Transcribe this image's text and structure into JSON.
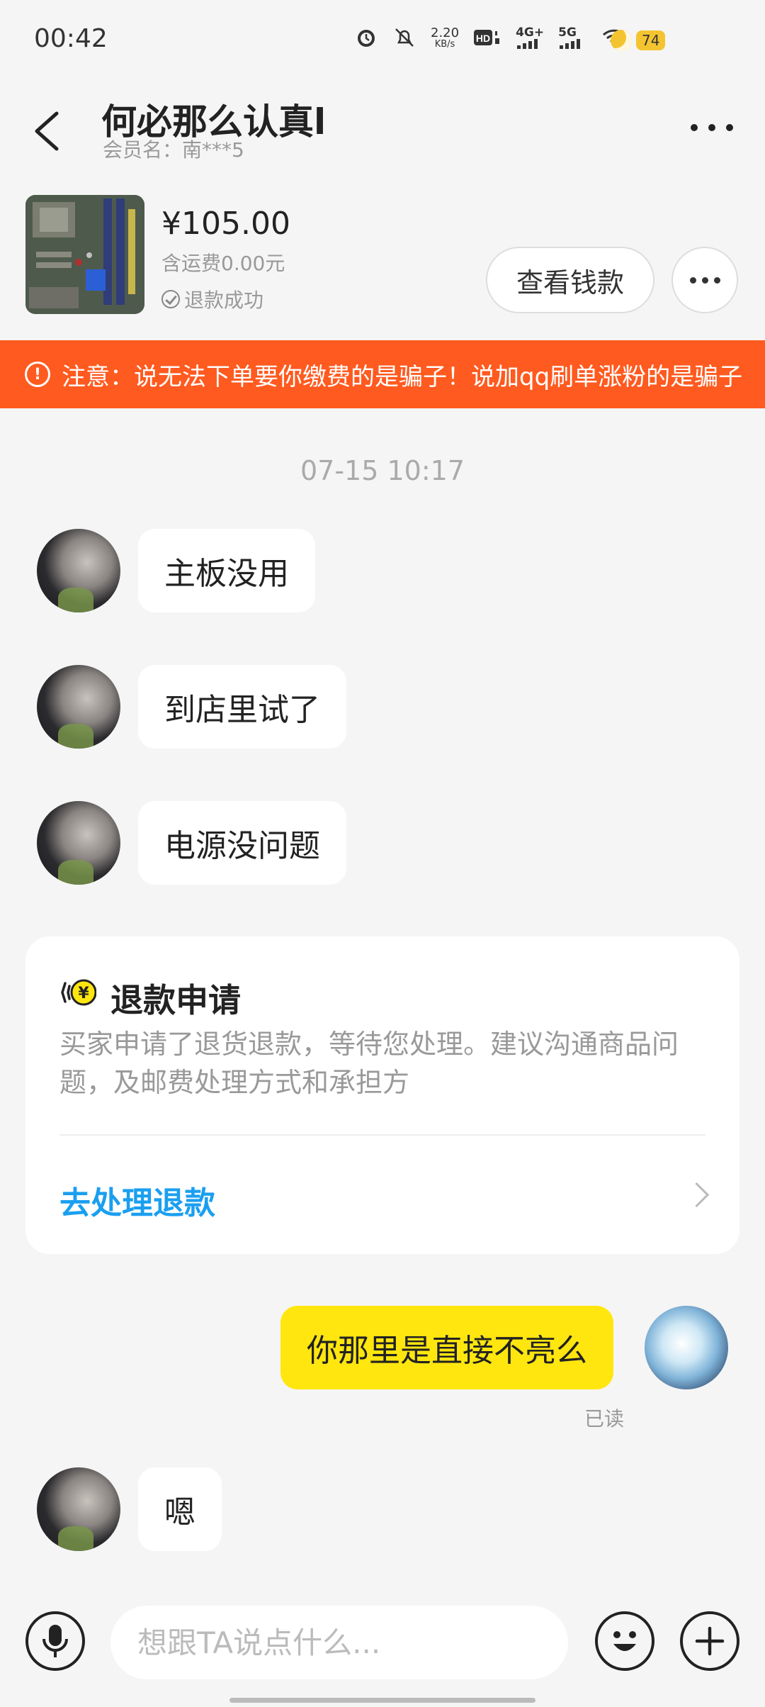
{
  "status_bar": {
    "time": "00:42",
    "net_speed": "2.20",
    "net_unit": "KB/s",
    "network_1": "4G+",
    "network_2": "5G",
    "battery": "74",
    "icons": [
      "alarm-icon",
      "mute-bell-icon",
      "hd-icon",
      "signal-4g-icon",
      "signal-5g-icon",
      "wifi-icon",
      "moon-icon"
    ]
  },
  "header": {
    "title": "何必那么认真l",
    "member_label": "会员名：南***5"
  },
  "product": {
    "price": "¥105.00",
    "shipping": "含运费0.00元",
    "refund_status": "退款成功",
    "view_refund_label": "查看钱款"
  },
  "warning": {
    "text": "注意：说无法下单要你缴费的是骗子！说加qq刷单涨粉的是骗子"
  },
  "chat": {
    "timestamp": "07-15 10:17",
    "messages": [
      {
        "side": "left",
        "text": "主板没用"
      },
      {
        "side": "left",
        "text": "到店里试了"
      },
      {
        "side": "left",
        "text": "电源没问题"
      },
      {
        "side": "right",
        "text": "你那里是直接不亮么",
        "read": "已读"
      },
      {
        "side": "left",
        "text": "嗯"
      }
    ]
  },
  "refund_card": {
    "title": "退款申请",
    "description": "买家申请了退货退款，等待您处理。建议沟通商品问题，及邮费处理方式和承担方",
    "action": "去处理退款"
  },
  "input": {
    "placeholder": "想跟TA说点什么..."
  },
  "colors": {
    "accent_yellow": "#ffe60f",
    "warning_orange": "#ff5a1f",
    "link_blue": "#1a9ff0"
  }
}
